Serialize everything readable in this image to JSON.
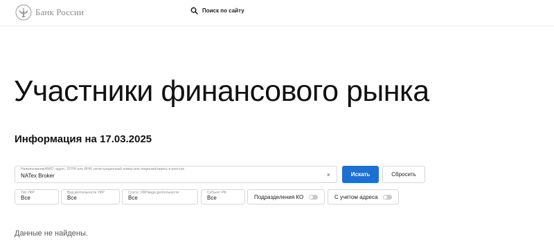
{
  "header": {
    "logo_text": "Банк России",
    "logo_icon": "eagle-emblem-icon",
    "search_label": "Поиск по сайту",
    "search_icon": "search-icon"
  },
  "main": {
    "title": "Участники финансового рынка",
    "info_date": "Информация на 17.03.2025"
  },
  "search_form": {
    "query_caption": "Наименование/ФИО, адрес, ОГРН или ИНН, регистрационный номер или лицензия/запись в реестре",
    "query_value": "NATex Broker",
    "clear_icon": "×",
    "search_button": "Искать",
    "reset_button": "Сбросить"
  },
  "filters": [
    {
      "caption": "Тип УФР",
      "value": "Все"
    },
    {
      "caption": "Вид деятельности УФР",
      "value": "Все"
    },
    {
      "caption": "Статус УФР/вида деятельности",
      "value": "Все"
    },
    {
      "caption": "Субъект РФ",
      "value": "Все"
    }
  ],
  "toggles": [
    {
      "label": "Подразделения КО",
      "state": "off"
    },
    {
      "label": "С учетом адреса",
      "state": "off"
    }
  ],
  "results": {
    "message": "Данные не найдены."
  },
  "colors": {
    "accent": "#1d6fd2",
    "border": "#d6d6d6",
    "muted_text": "#8a8a8a"
  }
}
